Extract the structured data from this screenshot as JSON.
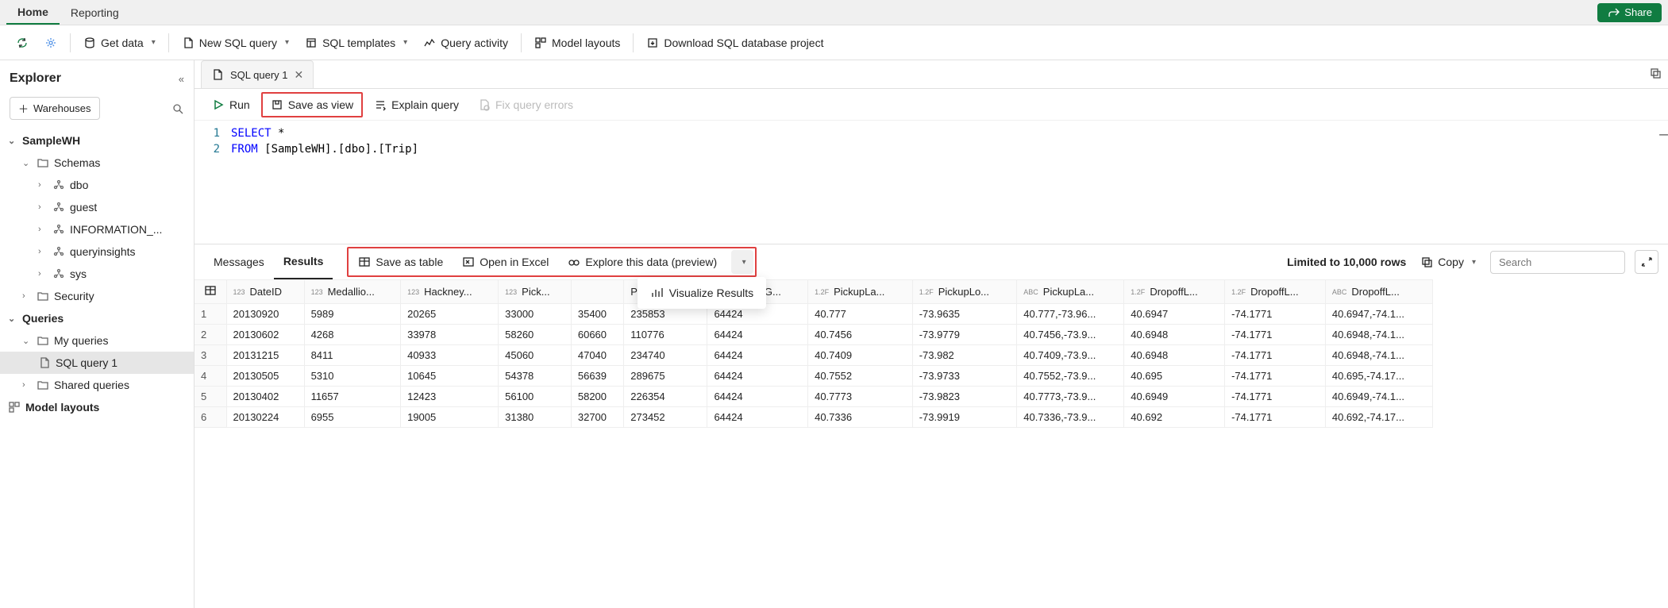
{
  "nav": {
    "home": "Home",
    "reporting": "Reporting",
    "share": "Share"
  },
  "toolbar": {
    "get_data": "Get data",
    "new_sql": "New SQL query",
    "templates": "SQL templates",
    "activity": "Query activity",
    "layouts": "Model layouts",
    "download": "Download SQL database project"
  },
  "explorer": {
    "title": "Explorer",
    "warehouses_btn": "Warehouses",
    "tree": {
      "root": "SampleWH",
      "schemas": "Schemas",
      "dbo": "dbo",
      "guest": "guest",
      "info": "INFORMATION_...",
      "qi": "queryinsights",
      "sys": "sys",
      "security": "Security",
      "queries": "Queries",
      "my_queries": "My queries",
      "sql_query_1": "SQL query 1",
      "shared_queries": "Shared queries",
      "model_layouts": "Model layouts"
    }
  },
  "editor": {
    "tab_title": "SQL query 1",
    "run": "Run",
    "save_view": "Save as view",
    "explain": "Explain query",
    "fix": "Fix query errors",
    "code": {
      "l1_num": "1",
      "l2_num": "2",
      "l1_kw": "SELECT",
      "l1_rest": " *",
      "l2_kw": "FROM",
      "l2_rest": " [SampleWH].[dbo].[Trip]"
    }
  },
  "results": {
    "messages_tab": "Messages",
    "results_tab": "Results",
    "save_table": "Save as table",
    "open_excel": "Open in Excel",
    "explore": "Explore this data (preview)",
    "visualize": "Visualize Results",
    "limit": "Limited to 10,000 rows",
    "copy": "Copy",
    "search_ph": "Search",
    "cols": [
      {
        "type": "",
        "name": ""
      },
      {
        "type": "123",
        "name": "DateID"
      },
      {
        "type": "123",
        "name": "Medallio..."
      },
      {
        "type": "123",
        "name": "Hackney..."
      },
      {
        "type": "123",
        "name": "Pick..."
      },
      {
        "type": "",
        "name": ""
      },
      {
        "type": "",
        "name": "PickupGe..."
      },
      {
        "type": "123",
        "name": "DropoffG..."
      },
      {
        "type": "1.2F",
        "name": "PickupLa..."
      },
      {
        "type": "1.2F",
        "name": "PickupLo..."
      },
      {
        "type": "ABC",
        "name": "PickupLa..."
      },
      {
        "type": "1.2F",
        "name": "DropoffL..."
      },
      {
        "type": "1.2F",
        "name": "DropoffL..."
      },
      {
        "type": "ABC",
        "name": "DropoffL..."
      }
    ],
    "rows": [
      [
        "1",
        "20130920",
        "5989",
        "20265",
        "33000",
        "35400",
        "235853",
        "64424",
        "40.777",
        "-73.9635",
        "40.777,-73.96...",
        "40.6947",
        "-74.1771",
        "40.6947,-74.1..."
      ],
      [
        "2",
        "20130602",
        "4268",
        "33978",
        "58260",
        "60660",
        "110776",
        "64424",
        "40.7456",
        "-73.9779",
        "40.7456,-73.9...",
        "40.6948",
        "-74.1771",
        "40.6948,-74.1..."
      ],
      [
        "3",
        "20131215",
        "8411",
        "40933",
        "45060",
        "47040",
        "234740",
        "64424",
        "40.7409",
        "-73.982",
        "40.7409,-73.9...",
        "40.6948",
        "-74.1771",
        "40.6948,-74.1..."
      ],
      [
        "4",
        "20130505",
        "5310",
        "10645",
        "54378",
        "56639",
        "289675",
        "64424",
        "40.7552",
        "-73.9733",
        "40.7552,-73.9...",
        "40.695",
        "-74.1771",
        "40.695,-74.17..."
      ],
      [
        "5",
        "20130402",
        "11657",
        "12423",
        "56100",
        "58200",
        "226354",
        "64424",
        "40.7773",
        "-73.9823",
        "40.7773,-73.9...",
        "40.6949",
        "-74.1771",
        "40.6949,-74.1..."
      ],
      [
        "6",
        "20130224",
        "6955",
        "19005",
        "31380",
        "32700",
        "273452",
        "64424",
        "40.7336",
        "-73.9919",
        "40.7336,-73.9...",
        "40.692",
        "-74.1771",
        "40.692,-74.17..."
      ]
    ]
  }
}
